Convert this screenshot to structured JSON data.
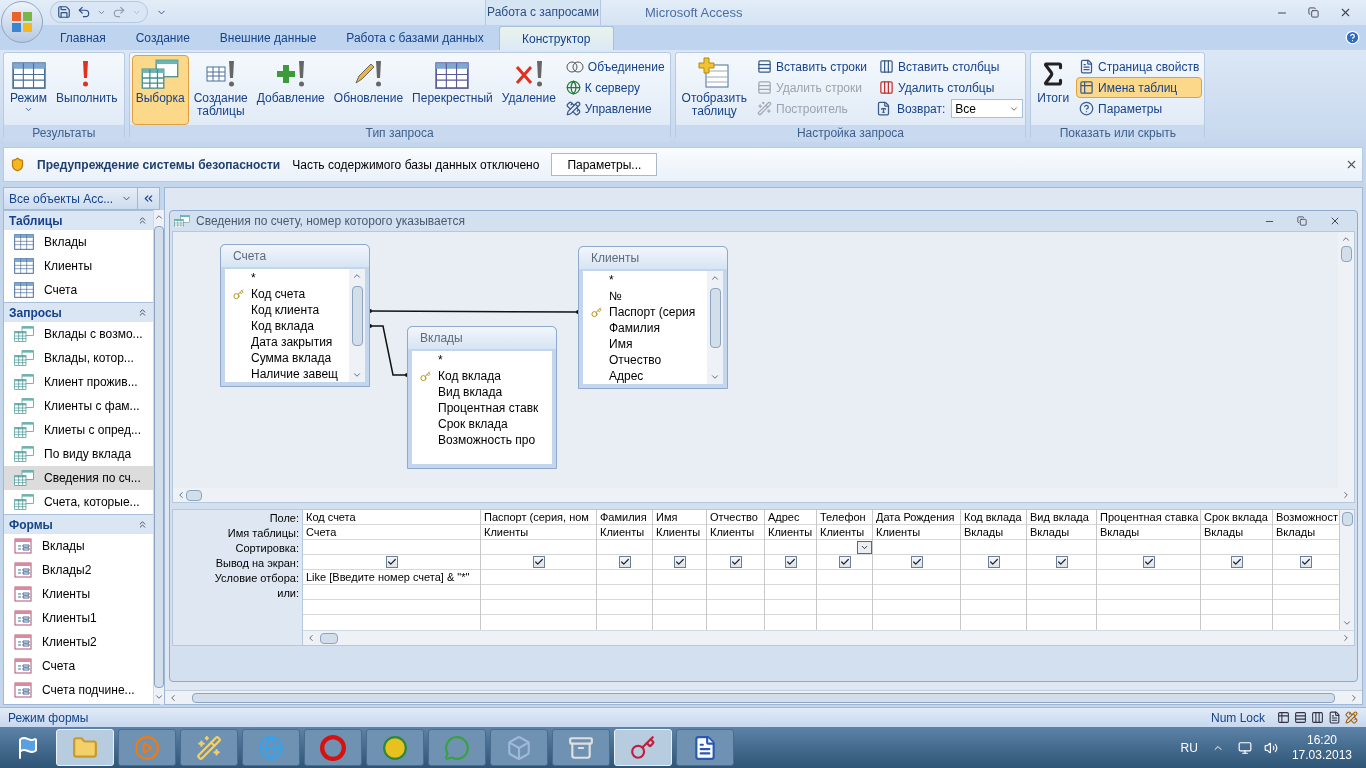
{
  "title_bar": {
    "context_label": "Работа с запросами",
    "title": "Microsoft Access"
  },
  "ribbon_tabs": [
    {
      "label": "Главная",
      "selected": false
    },
    {
      "label": "Создание",
      "selected": false
    },
    {
      "label": "Внешние данные",
      "selected": false
    },
    {
      "label": "Работа с базами данных",
      "selected": false
    },
    {
      "label": "Конструктор",
      "selected": true
    }
  ],
  "ribbon_groups": [
    {
      "label": "Результаты",
      "items": [
        {
          "kind": "large",
          "label": "Режим",
          "dropdown": true,
          "selected": false,
          "disabled": false
        },
        {
          "kind": "large",
          "label": "Выполнить",
          "dropdown": false,
          "selected": false,
          "disabled": false
        }
      ]
    },
    {
      "label": "Тип запроса",
      "items": [
        {
          "kind": "large",
          "label": "Выборка",
          "dropdown": false,
          "selected": true,
          "disabled": false
        },
        {
          "kind": "large",
          "label": "Создание таблицы",
          "dropdown": false,
          "selected": false,
          "disabled": false
        },
        {
          "kind": "large",
          "label": "Добавление",
          "dropdown": false,
          "selected": false,
          "disabled": false
        },
        {
          "kind": "large",
          "label": "Обновление",
          "dropdown": false,
          "selected": false,
          "disabled": false
        },
        {
          "kind": "large",
          "label": "Перекрестный",
          "dropdown": false,
          "selected": false,
          "disabled": false
        },
        {
          "kind": "large",
          "label": "Удаление",
          "dropdown": false,
          "selected": false,
          "disabled": false
        },
        {
          "kind": "small",
          "label": "Объединение",
          "selected": false,
          "disabled": false
        },
        {
          "kind": "small",
          "label": "К серверу",
          "selected": false,
          "disabled": false
        },
        {
          "kind": "small",
          "label": "Управление",
          "selected": false,
          "disabled": false
        }
      ]
    },
    {
      "label": "Настройка запроса",
      "items": [
        {
          "kind": "large",
          "label": "Отобразить таблицу",
          "dropdown": false,
          "selected": false,
          "disabled": false
        },
        {
          "kind": "small",
          "label": "Вставить строки",
          "selected": false,
          "disabled": false
        },
        {
          "kind": "small",
          "label": "Удалить строки",
          "selected": false,
          "disabled": true
        },
        {
          "kind": "small",
          "label": "Построитель",
          "selected": false,
          "disabled": true
        },
        {
          "kind": "small",
          "label": "Вставить столбцы",
          "selected": false,
          "disabled": false
        },
        {
          "kind": "small",
          "label": "Удалить столбцы",
          "selected": false,
          "disabled": false
        },
        {
          "kind": "combo",
          "label": "Возврат:",
          "value": "Все",
          "dropdown": true,
          "selected": false,
          "disabled": false
        }
      ]
    },
    {
      "label": "Показать или скрыть",
      "items": [
        {
          "kind": "large",
          "label": "Итоги",
          "dropdown": false,
          "selected": false,
          "disabled": false
        },
        {
          "kind": "small",
          "label": "Страница свойств",
          "selected": false,
          "disabled": false
        },
        {
          "kind": "small",
          "label": "Имена таблиц",
          "selected": true,
          "disabled": false
        },
        {
          "kind": "small",
          "label": "Параметры",
          "selected": false,
          "disabled": false
        }
      ]
    }
  ],
  "security_bar": {
    "title": "Предупреждение системы безопасности",
    "message": "Часть содержимого базы данных отключено",
    "button": "Параметры..."
  },
  "nav_pane": {
    "header": "Все объекты Acc...",
    "groups": [
      {
        "label": "Таблицы",
        "kind": "table",
        "items": [
          {
            "label": "Вклады",
            "selected": false
          },
          {
            "label": "Клиенты",
            "selected": false
          },
          {
            "label": "Счета",
            "selected": false
          }
        ]
      },
      {
        "label": "Запросы",
        "kind": "query",
        "items": [
          {
            "label": "Вклады с возмо...",
            "selected": false
          },
          {
            "label": "Вклады, котор...",
            "selected": false
          },
          {
            "label": "Клиент прожив...",
            "selected": false
          },
          {
            "label": "Клиенты с фам...",
            "selected": false
          },
          {
            "label": "Клиеты с опред...",
            "selected": false
          },
          {
            "label": "По виду вклада",
            "selected": false
          },
          {
            "label": "Сведения по сч...",
            "selected": true
          },
          {
            "label": "Счета, которые...",
            "selected": false
          }
        ]
      },
      {
        "label": "Формы",
        "kind": "form",
        "items": [
          {
            "label": "Вклады",
            "selected": false
          },
          {
            "label": "Вклады2",
            "selected": false
          },
          {
            "label": "Клиенты",
            "selected": false
          },
          {
            "label": "Клиенты1",
            "selected": false
          },
          {
            "label": "Клиенты2",
            "selected": false
          },
          {
            "label": "Счета",
            "selected": false
          },
          {
            "label": "Счета подчине...",
            "selected": false
          }
        ]
      }
    ]
  },
  "query_window": {
    "title": "Сведения по счету, номер которого указывается",
    "tables": [
      {
        "name": "Счета",
        "fields": [
          {
            "name": "*",
            "key": false
          },
          {
            "name": "Код счета",
            "key": true
          },
          {
            "name": "Код клиента",
            "key": false
          },
          {
            "name": "Код вклада",
            "key": false
          },
          {
            "name": "Дата закрытия",
            "key": false
          },
          {
            "name": "Сумма вклада",
            "key": false
          },
          {
            "name": "Наличие завещ",
            "key": false
          }
        ]
      },
      {
        "name": "Вклады",
        "fields": [
          {
            "name": "*",
            "key": false
          },
          {
            "name": "Код вклада",
            "key": true
          },
          {
            "name": "Вид вклада",
            "key": false
          },
          {
            "name": "Процентная ставк",
            "key": false
          },
          {
            "name": "Срок вклада",
            "key": false
          },
          {
            "name": "Возможность про",
            "key": false
          }
        ]
      },
      {
        "name": "Клиенты",
        "fields": [
          {
            "name": "*",
            "key": false
          },
          {
            "name": "№",
            "key": false
          },
          {
            "name": "Паспорт (серия",
            "key": true
          },
          {
            "name": "Фамилия",
            "key": false
          },
          {
            "name": "Имя",
            "key": false
          },
          {
            "name": "Отчество",
            "key": false
          },
          {
            "name": "Адрес",
            "key": false
          }
        ]
      }
    ],
    "grid": {
      "row_labels": [
        "Поле:",
        "Имя таблицы:",
        "Сортировка:",
        "Вывод на экран:",
        "Условие отбора:",
        "или:"
      ],
      "columns": [
        {
          "field": "Код счета",
          "table": "Счета",
          "show": true,
          "sort_dropdown": false,
          "criteria": "Like [Введите номер счета] & \"*\""
        },
        {
          "field": "Паспорт (серия, ном",
          "table": "Клиенты",
          "show": true,
          "sort_dropdown": false
        },
        {
          "field": "Фамилия",
          "table": "Клиенты",
          "show": true,
          "sort_dropdown": false
        },
        {
          "field": "Имя",
          "table": "Клиенты",
          "show": true,
          "sort_dropdown": false
        },
        {
          "field": "Отчество",
          "table": "Клиенты",
          "show": true,
          "sort_dropdown": false
        },
        {
          "field": "Адрес",
          "table": "Клиенты",
          "show": true,
          "sort_dropdown": false
        },
        {
          "field": "Телефон",
          "table": "Клиенты",
          "show": true,
          "sort_dropdown": true
        },
        {
          "field": "Дата Рождения",
          "table": "Клиенты",
          "show": true,
          "sort_dropdown": false
        },
        {
          "field": "Код вклада",
          "table": "Вклады",
          "show": true,
          "sort_dropdown": false
        },
        {
          "field": "Вид вклада",
          "table": "Вклады",
          "show": true,
          "sort_dropdown": false
        },
        {
          "field": "Процентная ставка",
          "table": "Вклады",
          "show": true,
          "sort_dropdown": false
        },
        {
          "field": "Срок вклада",
          "table": "Вклады",
          "show": true,
          "sort_dropdown": false
        },
        {
          "field": "Возможност",
          "table": "Вклады",
          "show": true,
          "sort_dropdown": false
        }
      ]
    }
  },
  "status_bar": {
    "mode": "Режим формы",
    "indicator": "Num Lock"
  },
  "taskbar": {
    "buttons": [
      {
        "selected": true
      },
      {
        "selected": false
      },
      {
        "selected": false
      },
      {
        "selected": false
      },
      {
        "selected": false
      },
      {
        "selected": false
      },
      {
        "selected": false
      },
      {
        "selected": false
      },
      {
        "selected": false
      },
      {
        "selected": true
      },
      {
        "selected": false
      }
    ],
    "language": "RU",
    "time": "16:20",
    "date": "17.03.2013"
  }
}
